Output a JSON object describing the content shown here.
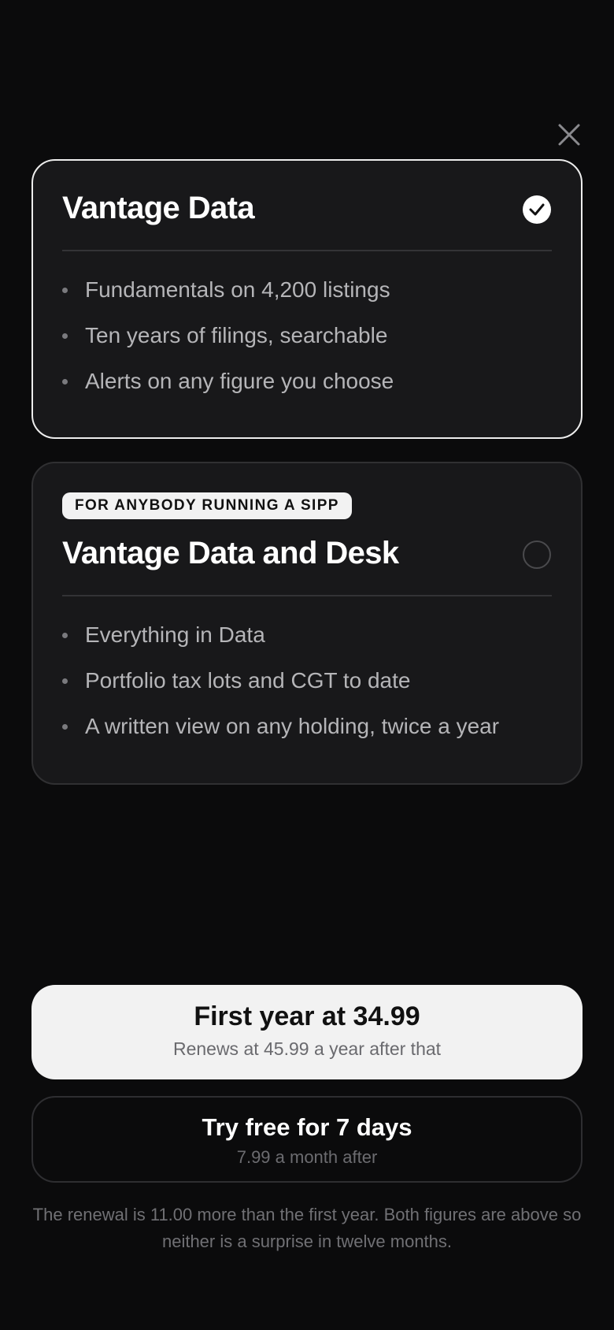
{
  "close": {
    "icon": "close-icon"
  },
  "plans": [
    {
      "title": "Vantage Data",
      "selected": true,
      "badge": "",
      "features": [
        "Fundamentals on 4,200 listings",
        "Ten years of filings, searchable",
        "Alerts on any figure you choose"
      ]
    },
    {
      "title": "Vantage Data and Desk",
      "selected": false,
      "badge": "FOR ANYBODY RUNNING A SIPP",
      "features": [
        "Everything in Data",
        "Portfolio tax lots and CGT to date",
        "A written view on any holding, twice a year"
      ]
    }
  ],
  "primary_cta": {
    "title": "First year at 34.99",
    "subtitle": "Renews at 45.99 a year after that"
  },
  "secondary_cta": {
    "title": "Try free for 7 days",
    "subtitle": "7.99 a month after"
  },
  "footnote": "The renewal is 11.00 more than the first year. Both figures are above so neither is a surprise in twelve months.",
  "colors": {
    "background": "#0b0b0c",
    "card": "#18181a",
    "selected_border": "#ededed",
    "primary_button": "#f2f2f2"
  }
}
